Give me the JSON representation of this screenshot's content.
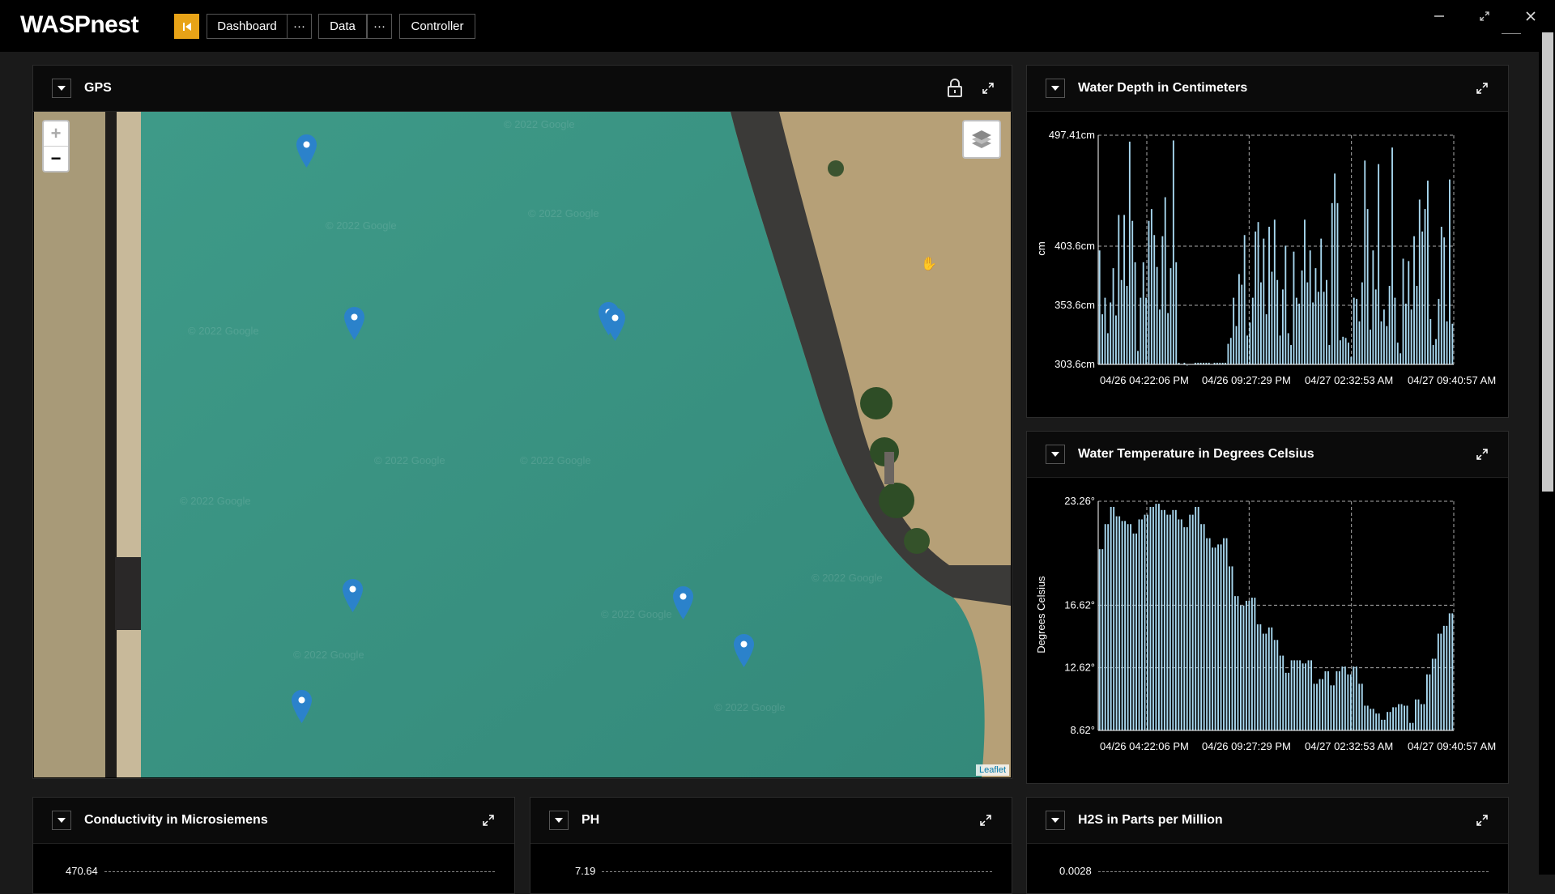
{
  "app": {
    "title": "WASPnest"
  },
  "nav": {
    "dashboard": "Dashboard",
    "more": "···",
    "data": "Data",
    "controller": "Controller"
  },
  "window_controls": {
    "minimize": "—",
    "restore": "⤡",
    "close": "✕"
  },
  "gps": {
    "title": "GPS",
    "zoom_in": "+",
    "zoom_out": "−",
    "attribution": "Leaflet",
    "watermark": "© 2022 Google",
    "markers": 9
  },
  "panels": {
    "depth": {
      "title": "Water Depth in Centimeters"
    },
    "temp": {
      "title": "Water Temperature in Degrees Celsius"
    },
    "cond": {
      "title": "Conductivity in Microsiemens",
      "top_tick": "470.64"
    },
    "ph": {
      "title": "PH",
      "top_tick": "7.19"
    },
    "h2s": {
      "title": "H2S in Parts per Million",
      "top_tick": "0.0028"
    }
  },
  "chart_data": [
    {
      "type": "bar",
      "title": "Water Depth in Centimeters",
      "ylabel": "cm",
      "ylim": [
        303.6,
        497.41
      ],
      "yticks": [
        "497.41cm",
        "403.6cm",
        "353.6cm",
        "303.6cm"
      ],
      "xticks": [
        "04/26 04:22:06 PM",
        "04/26 09:27:29 PM",
        "04/27 02:32:53 AM",
        "04/27 09:40:57 AM"
      ],
      "grid": true,
      "values": [
        400,
        346,
        360,
        330,
        356,
        385,
        345,
        430,
        375,
        430,
        370,
        492,
        425,
        390,
        315,
        360,
        390,
        360,
        425,
        435,
        413,
        386,
        350,
        412,
        445,
        347,
        385,
        493,
        390,
        305,
        304,
        305,
        303,
        304,
        304,
        305,
        305,
        305,
        305,
        305,
        305,
        304,
        305,
        305,
        305,
        305,
        305,
        321,
        326,
        360,
        336,
        380,
        371,
        413,
        328,
        339,
        360,
        416,
        424,
        373,
        410,
        346,
        420,
        382,
        426,
        375,
        328,
        367,
        404,
        330,
        320,
        399,
        360,
        355,
        383,
        426,
        373,
        400,
        356,
        385,
        365,
        410,
        365,
        375,
        320,
        440,
        465,
        440,
        324,
        327,
        326,
        322,
        310,
        360,
        359,
        340,
        373,
        476,
        435,
        333,
        400,
        367,
        473,
        340,
        350,
        336,
        370,
        487,
        360,
        322,
        313,
        393,
        355,
        391,
        350,
        412,
        370,
        443,
        416,
        435,
        459,
        342,
        320,
        325,
        359,
        420,
        411,
        340,
        460,
        338
      ]
    },
    {
      "type": "bar",
      "title": "Water Temperature in Degrees Celsius",
      "ylabel": "Degrees Celsius",
      "ylim": [
        8.62,
        23.26
      ],
      "yticks": [
        "23.26°",
        "16.62°",
        "12.62°",
        "8.62°"
      ],
      "xticks": [
        "04/26 04:22:06 PM",
        "04/26 09:27:29 PM",
        "04/27 02:32:53 AM",
        "04/27 09:40:57 AM"
      ],
      "grid": true,
      "values": [
        20.2,
        20.2,
        21.8,
        21.8,
        22.9,
        22.9,
        22.3,
        22.3,
        22.0,
        22.0,
        21.8,
        21.8,
        21.2,
        21.2,
        22.1,
        22.1,
        22.4,
        22.4,
        22.9,
        22.9,
        23.1,
        23.1,
        22.7,
        22.7,
        22.4,
        22.4,
        22.7,
        22.7,
        22.1,
        22.1,
        21.6,
        21.6,
        22.4,
        22.4,
        22.9,
        22.9,
        21.8,
        21.8,
        20.9,
        20.9,
        20.3,
        20.3,
        20.5,
        20.5,
        20.9,
        20.9,
        19.1,
        19.1,
        17.2,
        17.2,
        16.6,
        16.6,
        16.9,
        16.9,
        17.1,
        17.1,
        15.4,
        15.4,
        14.8,
        14.8,
        15.2,
        15.2,
        14.4,
        14.4,
        13.4,
        13.4,
        12.3,
        12.3,
        13.1,
        13.1,
        13.1,
        13.1,
        12.9,
        12.9,
        13.1,
        13.1,
        11.6,
        11.6,
        11.9,
        11.9,
        12.4,
        12.4,
        11.5,
        11.5,
        12.4,
        12.4,
        12.7,
        12.7,
        12.2,
        12.2,
        12.7,
        12.7,
        11.6,
        11.6,
        10.2,
        10.2,
        10.0,
        10.0,
        9.7,
        9.7,
        9.3,
        9.3,
        9.8,
        9.8,
        10.1,
        10.1,
        10.3,
        10.3,
        10.2,
        10.2,
        9.1,
        9.1,
        10.6,
        10.6,
        10.3,
        10.3,
        12.2,
        12.2,
        13.2,
        13.2,
        14.8,
        14.8,
        15.3,
        15.3,
        16.1,
        16.1
      ]
    }
  ]
}
